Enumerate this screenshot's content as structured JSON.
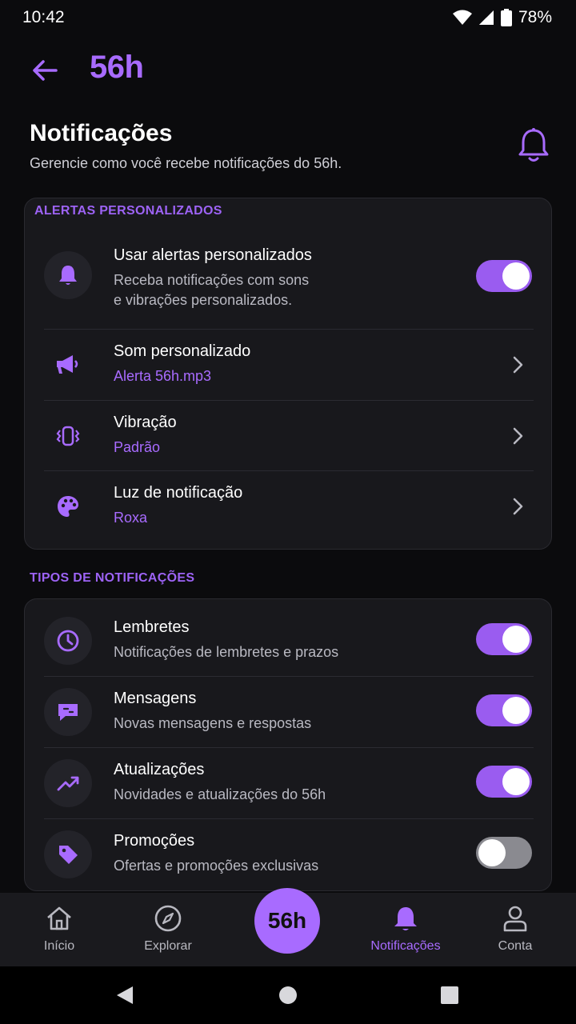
{
  "status_bar": {
    "time": "10:42",
    "battery": "78%"
  },
  "header": {
    "title": "56h"
  },
  "page": {
    "title": "Notificações",
    "subtitle": "Gerencie como você recebe notificações do 56h."
  },
  "alerts_section": {
    "label": "ALERTAS PERSONALIZADOS",
    "custom_alerts": {
      "title": "Usar alertas personalizados",
      "subtitle_line1": "Receba notificações com sons",
      "subtitle_line2": "e vibrações personalizados.",
      "enabled": true
    },
    "sound": {
      "title": "Som personalizado",
      "value": "Alerta 56h.mp3"
    },
    "vibration": {
      "title": "Vibração",
      "value": "Padrão"
    },
    "light": {
      "title": "Luz de notificação",
      "value": "Roxa"
    }
  },
  "types_section": {
    "label": "TIPOS DE NOTIFICAÇÕES",
    "items": [
      {
        "title": "Lembretes",
        "subtitle": "Notificações de lembretes e prazos",
        "enabled": true,
        "icon": "clock-icon"
      },
      {
        "title": "Mensagens",
        "subtitle": "Novas mensagens e respostas",
        "enabled": true,
        "icon": "chat-icon"
      },
      {
        "title": "Atualizações",
        "subtitle": "Novidades e atualizações do 56h",
        "enabled": true,
        "icon": "trending-icon"
      },
      {
        "title": "Promoções",
        "subtitle": "Ofertas e promoções exclusivas",
        "enabled": false,
        "icon": "tag-icon"
      }
    ]
  },
  "bottom_nav": {
    "home": "Início",
    "explore": "Explorar",
    "center": "56h",
    "notifications": "Notificações",
    "account": "Conta"
  },
  "colors": {
    "accent": "#a86bff",
    "background": "#0b0b0d",
    "card": "#18181c",
    "toggle_off": "#8a8a90"
  }
}
